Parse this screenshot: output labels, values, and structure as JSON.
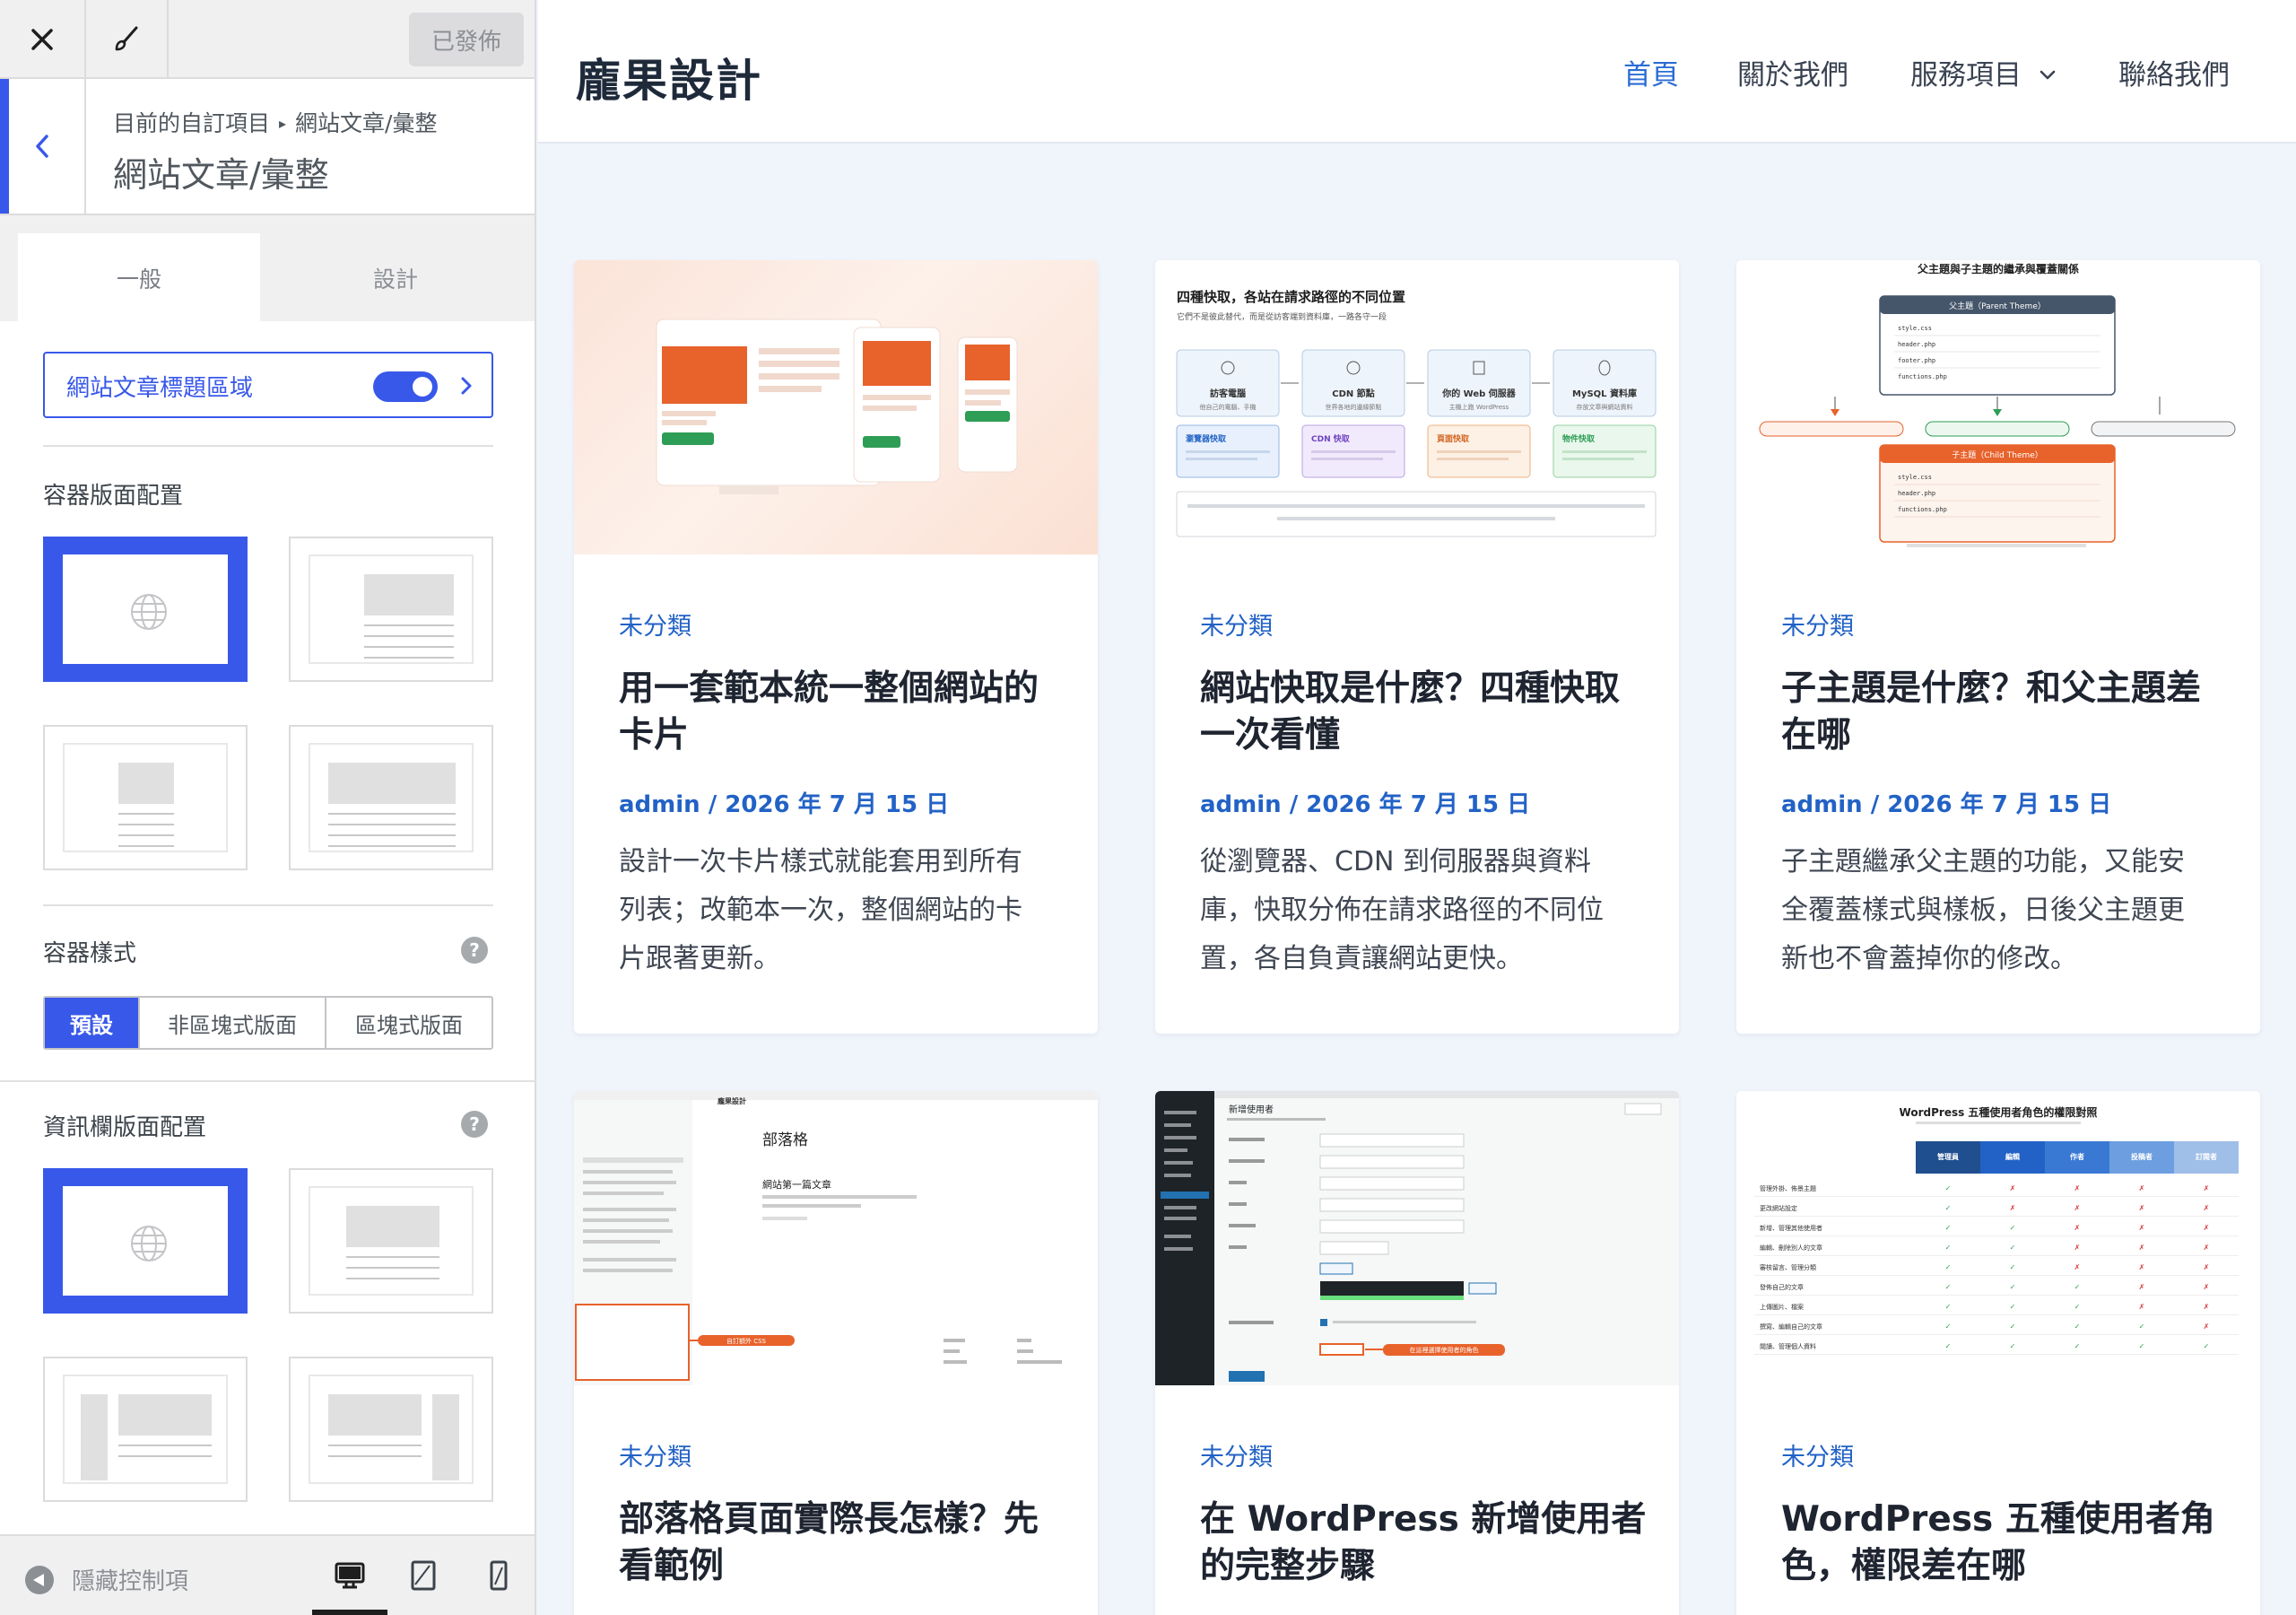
{
  "customizer": {
    "publish_label": "已發佈",
    "breadcrumb_prefix": "目前的自訂項目",
    "breadcrumb_current": "網站文章/彙整",
    "section_title": "網站文章/彙整",
    "tabs": [
      "一般",
      "設計"
    ],
    "title_area_toggle_label": "網站文章標題區域",
    "title_area_enabled": true,
    "container_layout_label": "容器版面配置",
    "container_style_label": "容器樣式",
    "container_style_options": [
      "預設",
      "非區塊式版面",
      "區塊式版面"
    ],
    "container_style_selected": "預設",
    "sidebar_layout_label": "資訊欄版面配置",
    "hide_controls_label": "隱藏控制項",
    "help_glyph": "?"
  },
  "site": {
    "title": "龐果設計",
    "nav": [
      {
        "label": "首頁",
        "active": true
      },
      {
        "label": "關於我們",
        "active": false
      },
      {
        "label": "服務項目",
        "active": false,
        "has_dropdown": true
      },
      {
        "label": "聯絡我們",
        "active": false
      }
    ]
  },
  "posts": [
    {
      "category": "未分類",
      "title_lines": [
        "用一套範本統一整個網站的",
        "卡片"
      ],
      "meta": "admin / 2026 年 7 月 15 日",
      "excerpt_lines": [
        "設計一次卡片樣式就能套用到所有",
        "列表；改範本一次，整個網站的卡",
        "片跟著更新。"
      ]
    },
    {
      "category": "未分類",
      "title_lines": [
        "網站快取是什麼？四種快取",
        "一次看懂"
      ],
      "meta": "admin / 2026 年 7 月 15 日",
      "excerpt_lines": [
        "從瀏覽器、CDN 到伺服器與資料",
        "庫，快取分佈在請求路徑的不同位",
        "置，各自負責讓網站更快。"
      ]
    },
    {
      "category": "未分類",
      "title_lines": [
        "子主題是什麼？和父主題差",
        "在哪"
      ],
      "meta": "admin / 2026 年 7 月 15 日",
      "excerpt_lines": [
        "子主題繼承父主題的功能，又能安",
        "全覆蓋樣式與樣板，日後父主題更",
        "新也不會蓋掉你的修改。"
      ]
    },
    {
      "category": "未分類",
      "title_lines": [
        "部落格頁面實際長怎樣？先",
        "看範例"
      ]
    },
    {
      "category": "未分類",
      "title_lines": [
        "在 WordPress 新增使用者",
        "的完整步驟"
      ]
    },
    {
      "category": "未分類",
      "title_lines": [
        "WordPress 五種使用者角",
        "色，權限差在哪"
      ]
    }
  ],
  "thumbs": {
    "cache": {
      "title": "四種快取，各站在請求路徑的不同位置",
      "subtitle": "它們不是彼此替代，而是從訪客端到資料庫，一路各守一段",
      "nodes": [
        "訪客電腦",
        "CDN 節點",
        "你的 Web 伺服器",
        "MySQL 資料庫"
      ],
      "node_subs": [
        "他自己的電腦、手機",
        "世界各地的邊緣節點",
        "主機上跑 WordPress",
        "存放文章與網站資料"
      ],
      "caches": [
        "瀏覽器快取",
        "CDN 快取",
        "頁面快取",
        "物件快取"
      ]
    },
    "child_theme": {
      "title": "父主題與子主題的繼承與覆蓋關係",
      "parent_label": "父主題（Parent Theme）",
      "child_label": "子主題（Child Theme）",
      "files": [
        "style.css",
        "header.php",
        "footer.php",
        "functions.php"
      ]
    },
    "blog": {
      "site_name": "龐果設計",
      "page_title": "部落格",
      "post_title": "網站第一篇文章",
      "badge_label": "自訂額外 CSS"
    },
    "add_user": {
      "heading": "新增使用者",
      "badge_label": "在這裡選擇使用者的角色"
    },
    "roles": {
      "title": "WordPress 五種使用者角色的權限對照",
      "columns": [
        "管理員",
        "編輯",
        "作者",
        "投稿者",
        "訂閱者"
      ],
      "rows": [
        "管理外掛、佈景主題",
        "更改網站設定",
        "新增、管理其他使用者",
        "編輯、刪除別人的文章",
        "審核留言、管理分類",
        "發佈自己的文章",
        "上傳圖片、檔案",
        "撰寫、編輯自己的文章",
        "閱讀、管理個人資料"
      ]
    }
  },
  "colors": {
    "accent": "#3858e9",
    "link": "#2262c6",
    "nav_active": "#2b6cd4",
    "orange": "#e8622b"
  },
  "icons": [
    "close-icon",
    "brush-icon",
    "chevron-left-icon",
    "chevron-right-icon",
    "globe-icon",
    "help-icon",
    "hide-controls-icon",
    "desktop-icon",
    "tablet-icon",
    "mobile-icon",
    "chevron-down-icon"
  ]
}
